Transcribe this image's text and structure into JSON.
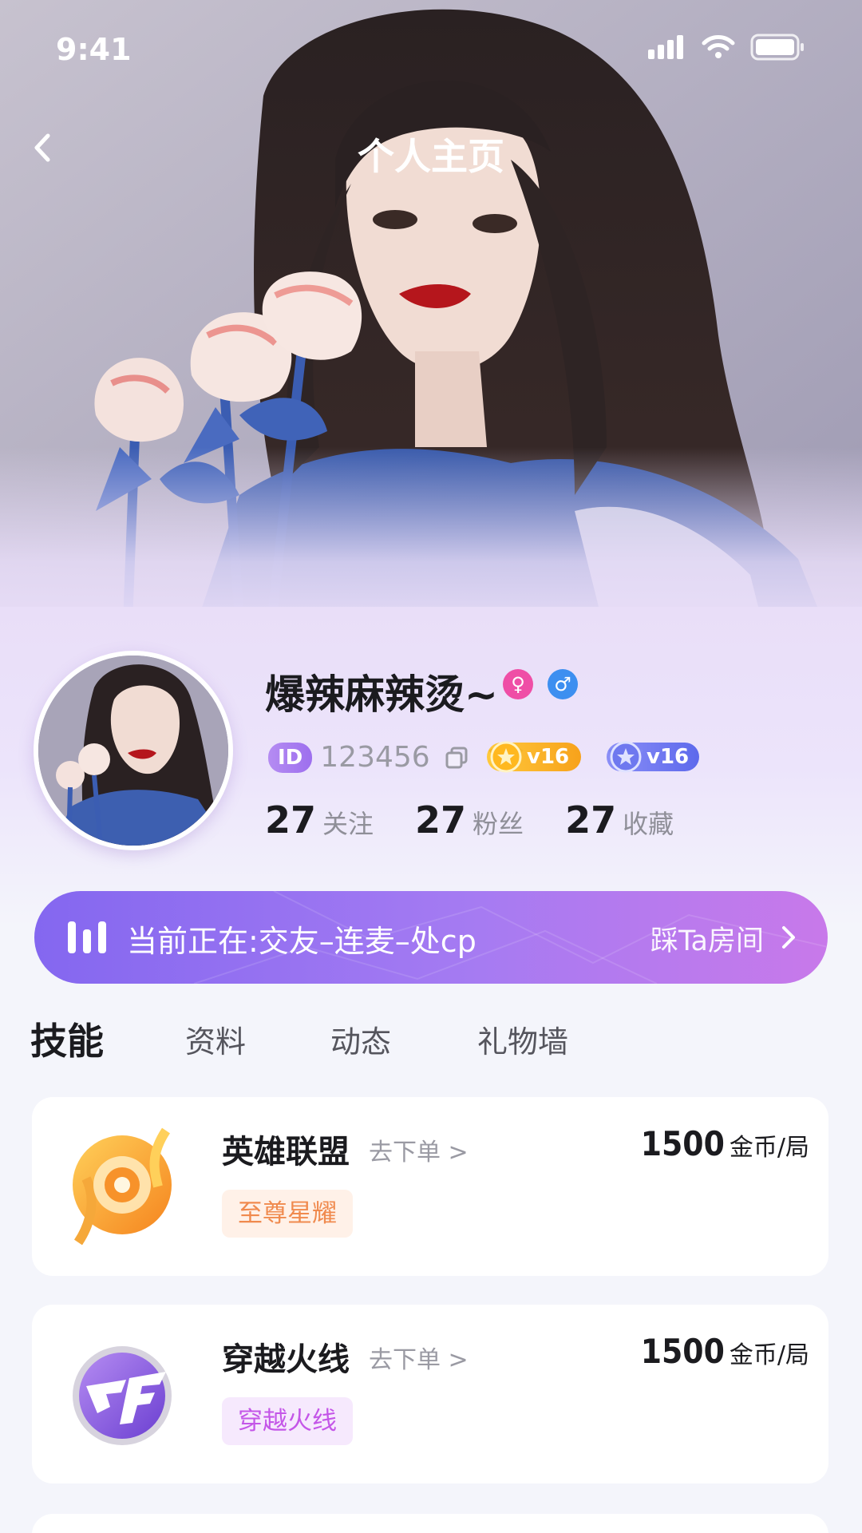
{
  "status_bar": {
    "time": "9:41"
  },
  "nav": {
    "title": "个人主页"
  },
  "profile": {
    "nickname": "爆辣麻辣烫~",
    "id_label": "ID",
    "id_value": "123456",
    "vip_gold": "v16",
    "vip_blue": "v16",
    "stats": [
      {
        "value": "27",
        "label": "关注"
      },
      {
        "value": "27",
        "label": "粉丝"
      },
      {
        "value": "27",
        "label": "收藏"
      }
    ]
  },
  "live": {
    "text": "当前正在:交友–连麦–处cp",
    "action": "踩Ta房间"
  },
  "tabs": [
    {
      "label": "技能",
      "active": true
    },
    {
      "label": "资料",
      "active": false
    },
    {
      "label": "动态",
      "active": false
    },
    {
      "label": "礼物墙",
      "active": false
    }
  ],
  "skills": [
    {
      "game": "英雄联盟",
      "order": "去下单 >",
      "price": "1500",
      "unit": "金币/局",
      "tag": "至尊星耀",
      "icon": "league-of-legends-icon"
    },
    {
      "game": "穿越火线",
      "order": "去下单 >",
      "price": "1500",
      "unit": "金币/局",
      "tag": "穿越火线",
      "icon": "crossfire-icon"
    }
  ],
  "colors": {
    "accent": "#9d6fee",
    "banner_start": "#8467f0",
    "banner_end": "#c879ea",
    "vip_gold": "#f7a21b",
    "vip_blue": "#5d69ec"
  }
}
